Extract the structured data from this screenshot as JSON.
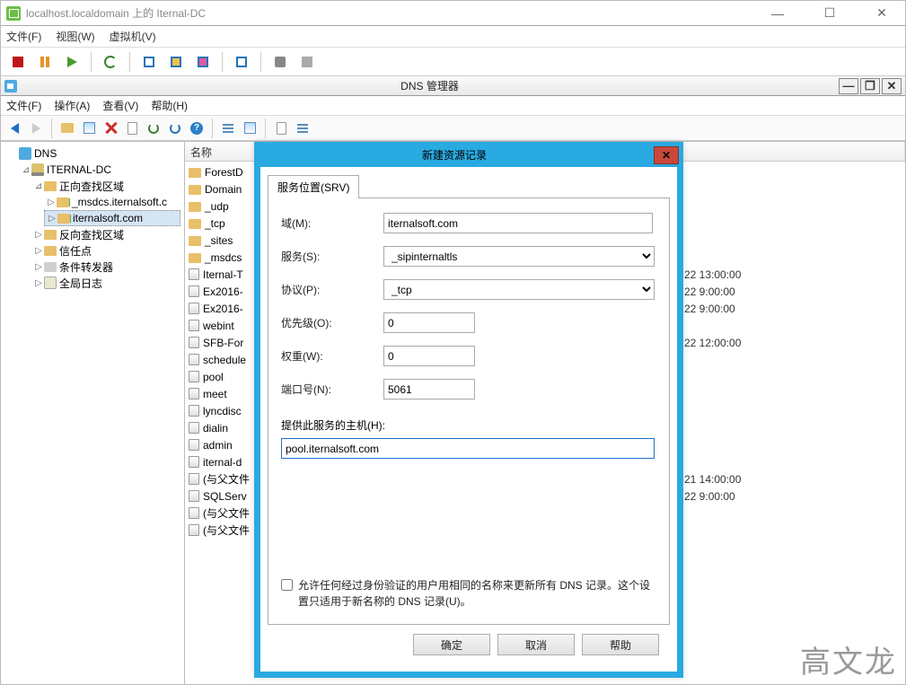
{
  "outerWindow": {
    "title": "localhost.localdomain 上的 Iternal-DC",
    "menus": {
      "file": "文件(F)",
      "view": "视图(W)",
      "vm": "虚拟机(V)"
    }
  },
  "dnsWindow": {
    "title": "DNS 管理器",
    "menus": {
      "file": "文件(F)",
      "action": "操作(A)",
      "view": "查看(V)",
      "help": "帮助(H)"
    }
  },
  "tree": {
    "root": "DNS",
    "server": "ITERNAL-DC",
    "fwdZone": "正向查找区域",
    "msdcs": "_msdcs.iternalsoft.c",
    "zone": "iternalsoft.com",
    "revZone": "反向查找区域",
    "trust": "信任点",
    "cond": "条件转发器",
    "global": "全局日志"
  },
  "listHeader": {
    "name": "名称"
  },
  "listItems": [
    {
      "type": "folder",
      "name": "ForestD",
      "ts": ""
    },
    {
      "type": "folder",
      "name": "Domain",
      "ts": ""
    },
    {
      "type": "folder",
      "name": "_udp",
      "ts": ""
    },
    {
      "type": "folder",
      "name": "_tcp",
      "ts": ""
    },
    {
      "type": "folder",
      "name": "_sites",
      "ts": ""
    },
    {
      "type": "folder",
      "name": "_msdcs",
      "ts": ""
    },
    {
      "type": "record",
      "name": "Iternal-T",
      "ts": "22 13:00:00"
    },
    {
      "type": "record",
      "name": "Ex2016-",
      "ts": "22 9:00:00"
    },
    {
      "type": "record",
      "name": "Ex2016-",
      "ts": "22 9:00:00"
    },
    {
      "type": "record",
      "name": "webint",
      "ts": ""
    },
    {
      "type": "record",
      "name": "SFB-For",
      "ts": "22 12:00:00"
    },
    {
      "type": "record",
      "name": "schedule",
      "ts": ""
    },
    {
      "type": "record",
      "name": "pool",
      "ts": ""
    },
    {
      "type": "record",
      "name": "meet",
      "ts": ""
    },
    {
      "type": "record",
      "name": "lyncdisc",
      "ts": ""
    },
    {
      "type": "record",
      "name": "dialin",
      "ts": ""
    },
    {
      "type": "record",
      "name": "admin",
      "ts": ""
    },
    {
      "type": "record",
      "name": "iternal-d",
      "ts": ""
    },
    {
      "type": "record",
      "name": "(与父文件",
      "ts": "21 14:00:00"
    },
    {
      "type": "record",
      "name": "SQLServ",
      "ts": "22 9:00:00"
    },
    {
      "type": "record",
      "name": "(与父文件",
      "ts": ""
    },
    {
      "type": "record",
      "name": "(与父文件",
      "ts": ""
    }
  ],
  "modal": {
    "title": "新建资源记录",
    "tab": "服务位置(SRV)",
    "labels": {
      "domain": "域(M):",
      "service": "服务(S):",
      "protocol": "协议(P):",
      "priority": "优先级(O):",
      "weight": "权重(W):",
      "port": "端口号(N):",
      "host": "提供此服务的主机(H):",
      "checkbox": "允许任何经过身份验证的用户用相同的名称来更新所有 DNS 记录。这个设置只适用于新名称的 DNS 记录(U)。"
    },
    "values": {
      "domain": "iternalsoft.com",
      "service": "_sipinternaltls",
      "protocol": "_tcp",
      "priority": "0",
      "weight": "0",
      "port": "5061",
      "host": "pool.iternalsoft.com"
    },
    "buttons": {
      "ok": "确定",
      "cancel": "取消",
      "help": "帮助"
    }
  },
  "watermark": "高文龙"
}
